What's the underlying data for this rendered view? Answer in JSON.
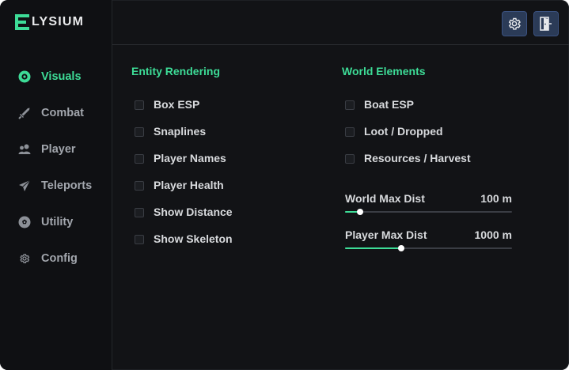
{
  "app": {
    "logo_text": "LYSIUM",
    "logo_letter": "E",
    "accent": "#3ddc97"
  },
  "sidebar": {
    "items": [
      {
        "label": "Visuals",
        "icon": "eye-icon",
        "active": true
      },
      {
        "label": "Combat",
        "icon": "sword-icon",
        "active": false
      },
      {
        "label": "Player",
        "icon": "users-icon",
        "active": false
      },
      {
        "label": "Teleports",
        "icon": "send-icon",
        "active": false
      },
      {
        "label": "Utility",
        "icon": "ball-icon",
        "active": false
      },
      {
        "label": "Config",
        "icon": "gear-icon",
        "active": false
      }
    ]
  },
  "topbar": {
    "settings_icon": "gear-icon",
    "exit_icon": "exit-door-icon"
  },
  "entity": {
    "title": "Entity Rendering",
    "options": [
      {
        "label": "Box ESP",
        "checked": false
      },
      {
        "label": "Snaplines",
        "checked": false
      },
      {
        "label": "Player Names",
        "checked": false
      },
      {
        "label": "Player Health",
        "checked": false
      },
      {
        "label": "Show Distance",
        "checked": false
      },
      {
        "label": "Show Skeleton",
        "checked": false
      }
    ]
  },
  "world": {
    "title": "World Elements",
    "options": [
      {
        "label": "Boat ESP",
        "checked": false
      },
      {
        "label": "Loot / Dropped",
        "checked": false
      },
      {
        "label": "Resources / Harvest",
        "checked": false
      }
    ],
    "sliders": [
      {
        "label": "World Max Dist",
        "value": "100 m",
        "fraction": 0.09
      },
      {
        "label": "Player Max Dist",
        "value": "1000 m",
        "fraction": 0.337
      }
    ]
  }
}
